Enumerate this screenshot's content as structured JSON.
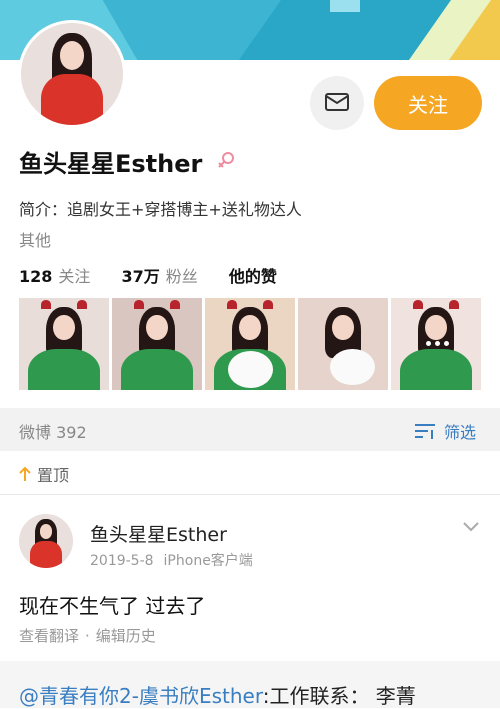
{
  "profile": {
    "name": "鱼头星星Esther",
    "bio": "简介：追剧女王+穿搭博主+送礼物达人",
    "other_label": "其他",
    "follow_label": "关注",
    "stats": {
      "following_count": "128",
      "following_label": "关注",
      "followers_count": "37万",
      "followers_label": "粉丝",
      "likes_label": "他的赞"
    }
  },
  "feed_header": {
    "weibo_count_label": "微博 392",
    "filter_label": "筛选"
  },
  "pinned_label": "置顶",
  "post": {
    "author": "鱼头星星Esther",
    "date": "2019-5-8",
    "client": "iPhone客户端",
    "text": "现在不生气了 过去了",
    "translate_label": "查看翻译",
    "separator": "·",
    "edit_history_label": "编辑历史"
  },
  "repost": {
    "mention": "@青春有你2-虞书欣Esther",
    "text": ":工作联系： 李菁"
  },
  "colors": {
    "accent_orange": "#f5a623",
    "link_blue": "#3a7ec2",
    "banner_blue": "#3cb4d2"
  },
  "icons": [
    "message-icon",
    "female-gender-icon",
    "filter-icon",
    "pin-arrow-icon",
    "chevron-down-icon"
  ]
}
